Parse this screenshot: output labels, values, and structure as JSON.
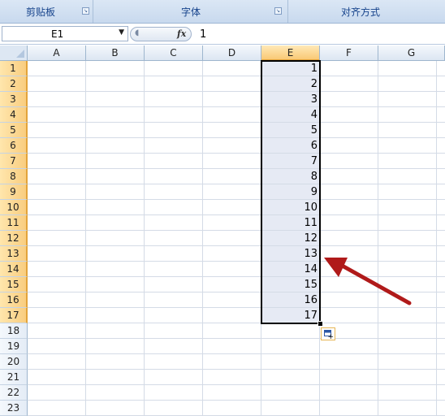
{
  "ribbon": {
    "groups": [
      {
        "label": "剪贴板"
      },
      {
        "label": "字体"
      },
      {
        "label": "对齐方式"
      }
    ]
  },
  "formula_bar": {
    "name_box": "E1",
    "fx_label": "fx",
    "content": "1"
  },
  "sheet": {
    "columns": [
      "A",
      "B",
      "C",
      "D",
      "E",
      "F",
      "G"
    ],
    "rows": [
      "1",
      "2",
      "3",
      "4",
      "5",
      "6",
      "7",
      "8",
      "9",
      "10",
      "11",
      "12",
      "13",
      "14",
      "15",
      "16",
      "17",
      "18",
      "19",
      "20",
      "21",
      "22",
      "23"
    ],
    "selected_column": "E",
    "selected_range": "E1:E17",
    "column_e_values": [
      "1",
      "2",
      "3",
      "4",
      "5",
      "6",
      "7",
      "8",
      "9",
      "10",
      "11",
      "12",
      "13",
      "14",
      "15",
      "16",
      "17"
    ]
  },
  "colors": {
    "arrow": "#b01a1a",
    "selection_fill": "#e6eaf4",
    "header_highlight": "#f9c975"
  },
  "icons": {
    "auto_fill_options": "auto-fill-options-icon",
    "dialog_launcher": "dialog-launcher-icon"
  }
}
